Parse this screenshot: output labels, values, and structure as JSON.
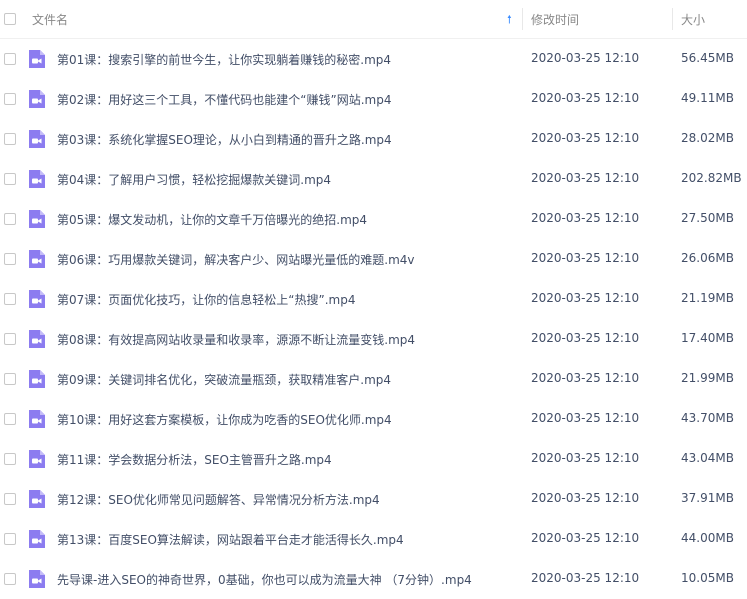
{
  "header": {
    "name_label": "文件名",
    "time_label": "修改时间",
    "size_label": "大小"
  },
  "files": [
    {
      "name": "第01课：搜索引擎的前世今生，让你实现躺着赚钱的秘密.mp4",
      "time": "2020-03-25 12:10",
      "size": "56.45MB"
    },
    {
      "name": "第02课：用好这三个工具，不懂代码也能建个“赚钱”网站.mp4",
      "time": "2020-03-25 12:10",
      "size": "49.11MB"
    },
    {
      "name": "第03课：系统化掌握SEO理论，从小白到精通的晋升之路.mp4",
      "time": "2020-03-25 12:10",
      "size": "28.02MB"
    },
    {
      "name": "第04课：了解用户习惯，轻松挖掘爆款关键词.mp4",
      "time": "2020-03-25 12:10",
      "size": "202.82MB"
    },
    {
      "name": "第05课：爆文发动机，让你的文章千万倍曝光的绝招.mp4",
      "time": "2020-03-25 12:10",
      "size": "27.50MB"
    },
    {
      "name": "第06课：巧用爆款关键词，解决客户少、网站曝光量低的难题.m4v",
      "time": "2020-03-25 12:10",
      "size": "26.06MB"
    },
    {
      "name": "第07课：页面优化技巧，让你的信息轻松上“热搜”.mp4",
      "time": "2020-03-25 12:10",
      "size": "21.19MB"
    },
    {
      "name": "第08课：有效提高网站收录量和收录率，源源不断让流量变钱.mp4",
      "time": "2020-03-25 12:10",
      "size": "17.40MB"
    },
    {
      "name": "第09课：关键词排名优化，突破流量瓶颈，获取精准客户.mp4",
      "time": "2020-03-25 12:10",
      "size": "21.99MB"
    },
    {
      "name": "第10课：用好这套方案模板，让你成为吃香的SEO优化师.mp4",
      "time": "2020-03-25 12:10",
      "size": "43.70MB"
    },
    {
      "name": "第11课：学会数据分析法，SEO主管晋升之路.mp4",
      "time": "2020-03-25 12:10",
      "size": "43.04MB"
    },
    {
      "name": "第12课：SEO优化师常见问题解答、异常情况分析方法.mp4",
      "time": "2020-03-25 12:10",
      "size": "37.91MB"
    },
    {
      "name": "第13课：百度SEO算法解读，网站跟着平台走才能活得长久.mp4",
      "time": "2020-03-25 12:10",
      "size": "44.00MB"
    },
    {
      "name": "先导课-进入SEO的神奇世界，0基础，你也可以成为流量大神 （7分钟）.mp4",
      "time": "2020-03-25 12:10",
      "size": "10.05MB"
    }
  ],
  "colors": {
    "video_icon": "#8c7cf0",
    "sort_arrow": "#3b8cff"
  },
  "icons": {
    "file": "video-file-icon",
    "sort": "sort-ascending-arrow-icon"
  }
}
